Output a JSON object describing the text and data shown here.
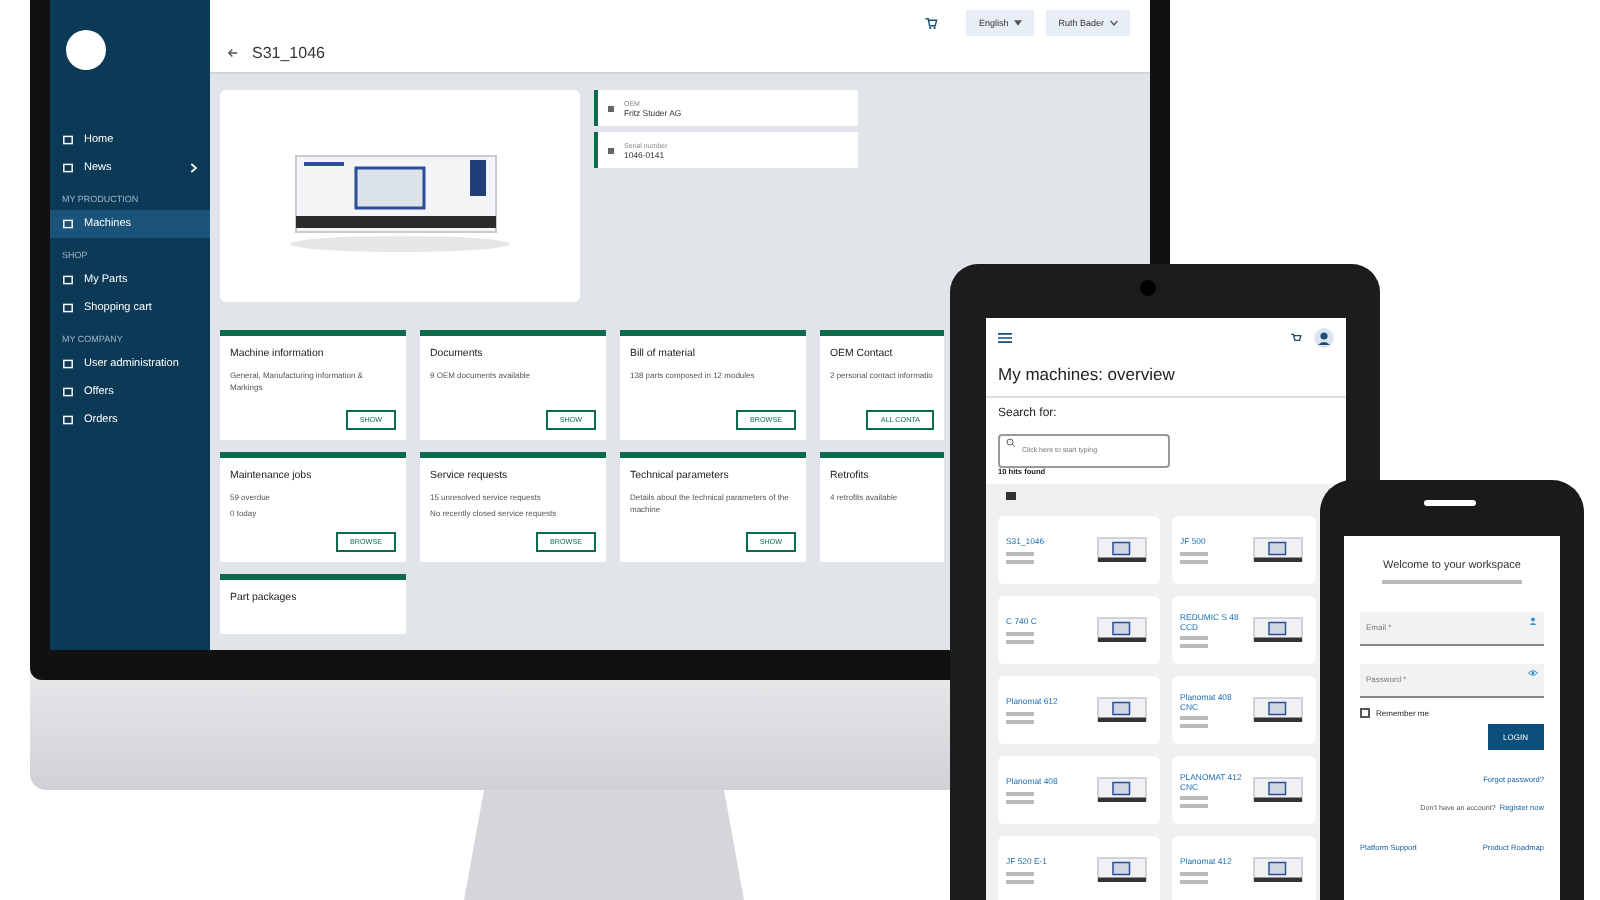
{
  "desktop": {
    "sidebar": {
      "sections": [
        {
          "items": [
            {
              "label": "Home",
              "selected": false,
              "submenu": false
            },
            {
              "label": "News",
              "selected": false,
              "submenu": true
            }
          ]
        },
        {
          "heading": "MY PRODUCTION",
          "items": [
            {
              "label": "Machines",
              "selected": true,
              "submenu": false
            }
          ]
        },
        {
          "heading": "SHOP",
          "items": [
            {
              "label": "My Parts",
              "selected": false,
              "submenu": false
            },
            {
              "label": "Shopping cart",
              "selected": false,
              "submenu": false
            }
          ]
        },
        {
          "heading": "MY COMPANY",
          "items": [
            {
              "label": "User administration",
              "selected": false,
              "submenu": false
            },
            {
              "label": "Offers",
              "selected": false,
              "submenu": false
            },
            {
              "label": "Orders",
              "selected": false,
              "submenu": false
            }
          ]
        }
      ]
    },
    "header": {
      "language": "English",
      "user": "Ruth Bader",
      "title": "S31_1046"
    },
    "info": [
      {
        "label": "OEM",
        "value": "Fritz Studer AG"
      },
      {
        "label": "Serial number",
        "value": "1046-0141"
      }
    ],
    "cards": [
      {
        "title": "Machine information",
        "lines": [
          "General, Manufacturing information & Markings"
        ],
        "button": "SHOW"
      },
      {
        "title": "Documents",
        "lines": [
          "9 OEM documents available"
        ],
        "button": "SHOW"
      },
      {
        "title": "Bill of material",
        "lines": [
          "138 parts composed in 12 modules"
        ],
        "button": "BROWSE"
      },
      {
        "title": "OEM Contact",
        "lines": [
          "2 personal contact informatio"
        ],
        "button": "ALL CONTA"
      },
      {
        "title": "Maintenance jobs",
        "lines": [
          "59 overdue",
          "0 today"
        ],
        "button": "BROWSE"
      },
      {
        "title": "Service requests",
        "lines": [
          "15 unresolved service requests",
          "No recently closed service requests"
        ],
        "button": "BROWSE"
      },
      {
        "title": "Technical parameters",
        "lines": [
          "Details about the technical parameters of the machine"
        ],
        "button": "SHOW"
      },
      {
        "title": "Retrofits",
        "lines": [
          "4 retrofits available"
        ]
      },
      {
        "title": "Part packages"
      }
    ]
  },
  "tablet": {
    "title": "My machines: overview",
    "search_label": "Search for:",
    "search": {
      "placeholder": "Click here to start typing"
    },
    "hits": "10 hits found",
    "machines": [
      "S31_1046",
      "JF 500",
      "C 740 C",
      "REDUMIC S 48 CCD",
      "Planomat 612",
      "Planomat 408 CNC",
      "Planomat 408",
      "PLANOMAT 412 CNC",
      "JF 520 E-1",
      "Planomat 412"
    ]
  },
  "phone": {
    "title": "Welcome to your workspace",
    "email": {
      "placeholder": "Email *"
    },
    "password": {
      "placeholder": "Password *"
    },
    "remember": {
      "label": "Remember me",
      "checked": false
    },
    "login": "LOGIN",
    "forgot": "Forgot password?",
    "register_prompt": "Don't have an account?",
    "register": "Register now",
    "links": [
      "Platform Support",
      "Product Roadmap"
    ]
  }
}
